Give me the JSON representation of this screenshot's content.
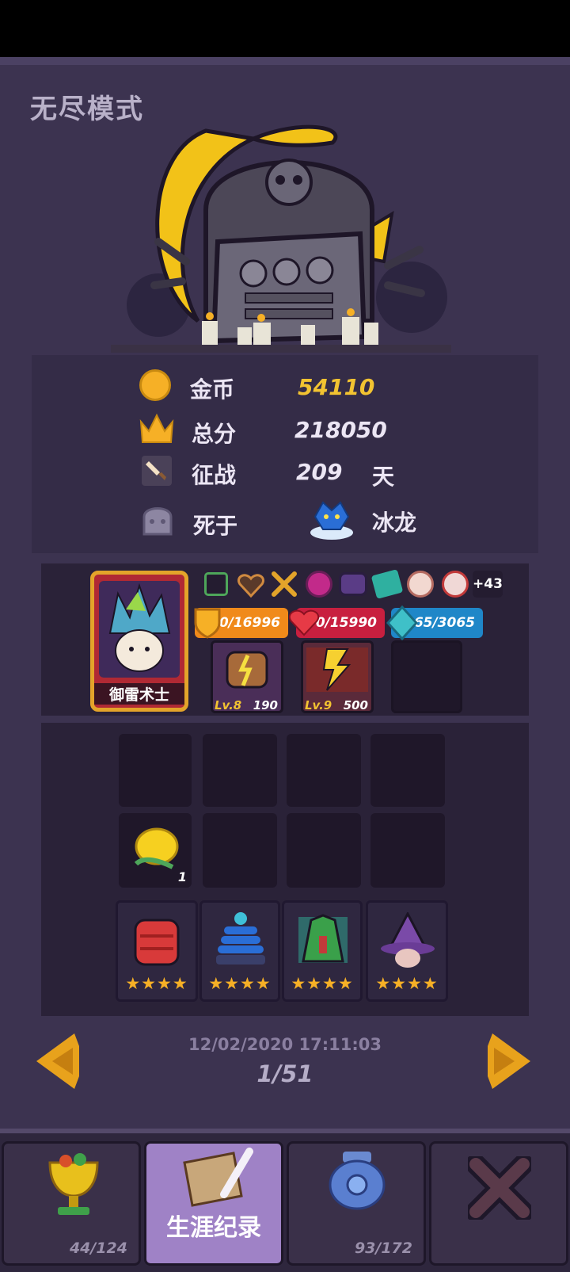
{
  "header": {
    "title": "无尽模式"
  },
  "stats": {
    "gold_label": "金币",
    "gold_value": "54110",
    "score_label": "总分",
    "score_value": "218050",
    "campaign_label": "征战",
    "campaign_days": "209",
    "campaign_unit": "天",
    "died_label": "死于",
    "died_by": "冰龙"
  },
  "hero": {
    "name": "御雷术士",
    "more_items": "+43",
    "shield": "0/16996",
    "health": "0/15990",
    "mana": "3065/3065",
    "skills": [
      {
        "level": "Lv.8",
        "value": "190"
      },
      {
        "level": "Lv.9",
        "value": "500"
      }
    ]
  },
  "inventory": {
    "lemon_count": "1",
    "stars": [
      "★★★★",
      "★★★★",
      "★★★★",
      "★★★★"
    ]
  },
  "record": {
    "timestamp": "12/02/2020 17:11:03",
    "page": "1/51"
  },
  "tabs": [
    {
      "count": "44/124"
    },
    {
      "label": "生涯纪录"
    },
    {
      "count": "93/172"
    },
    {
      "close": ""
    }
  ],
  "colors": {
    "accent": "#f2c331",
    "panel": "#3c3350",
    "active_tab": "#9f82c6"
  }
}
